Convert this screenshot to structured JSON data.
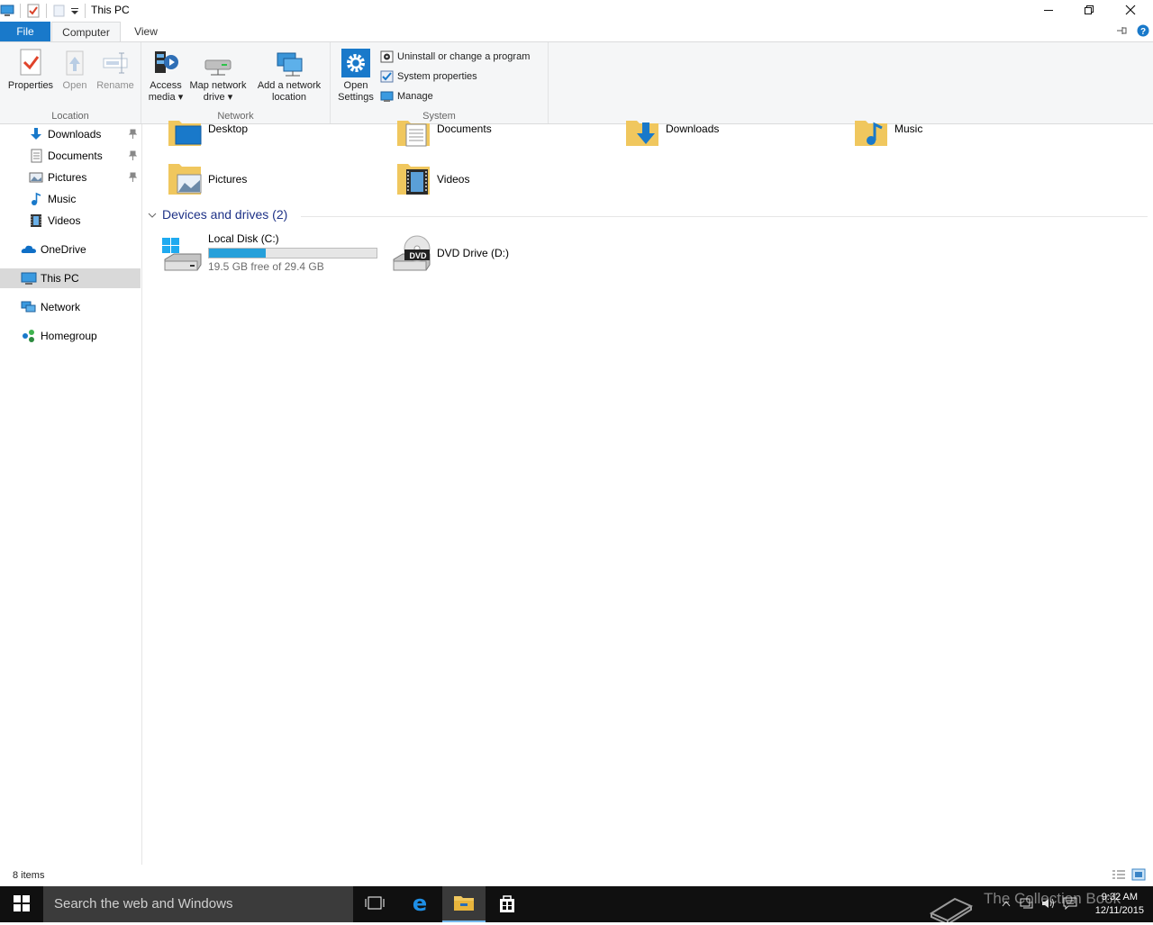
{
  "window": {
    "title": "This PC"
  },
  "ribbon": {
    "tabs": [
      {
        "label": "File"
      },
      {
        "label": "Computer"
      },
      {
        "label": "View"
      }
    ],
    "location_group": {
      "label": "Location",
      "properties": "Properties",
      "open": "Open",
      "rename": "Rename"
    },
    "network_group": {
      "label": "Network",
      "access_media_1": "Access",
      "access_media_2": "media",
      "map_drive_1": "Map network",
      "map_drive_2": "drive",
      "add_location_1": "Add a network",
      "add_location_2": "location"
    },
    "system_group": {
      "label": "System",
      "open_settings_1": "Open",
      "open_settings_2": "Settings",
      "uninstall": "Uninstall or change a program",
      "system_properties": "System properties",
      "manage": "Manage"
    }
  },
  "nav": {
    "items": [
      {
        "label": "Downloads",
        "pinned": true
      },
      {
        "label": "Documents",
        "pinned": true
      },
      {
        "label": "Pictures",
        "pinned": true
      },
      {
        "label": "Music",
        "pinned": false
      },
      {
        "label": "Videos",
        "pinned": false
      },
      {
        "label": "OneDrive",
        "pinned": false
      },
      {
        "label": "This PC",
        "pinned": false,
        "selected": true
      },
      {
        "label": "Network",
        "pinned": false
      },
      {
        "label": "Homegroup",
        "pinned": false
      }
    ]
  },
  "folders": [
    {
      "label": "Desktop",
      "icon": "desktop-folder-icon"
    },
    {
      "label": "Documents",
      "icon": "documents-folder-icon"
    },
    {
      "label": "Downloads",
      "icon": "downloads-folder-icon"
    },
    {
      "label": "Music",
      "icon": "music-folder-icon"
    },
    {
      "label": "Pictures",
      "icon": "pictures-folder-icon"
    },
    {
      "label": "Videos",
      "icon": "videos-folder-icon"
    }
  ],
  "devices": {
    "header": "Devices and drives (2)",
    "drives": [
      {
        "label": "Local Disk (C:)",
        "free_text": "19.5 GB free of 29.4 GB",
        "used_fraction": 0.337
      },
      {
        "label": "DVD Drive (D:)",
        "badge": "DVD"
      }
    ]
  },
  "status": {
    "item_count": "8 items"
  },
  "taskbar": {
    "search_placeholder": "Search the web and Windows",
    "time": "9:32 AM",
    "date": "12/11/2015",
    "watermark": "The Collection Book"
  },
  "colors": {
    "accent": "#1979ca",
    "progress": "#26a0da",
    "section_header": "#1e3287",
    "taskbar": "#101010"
  }
}
